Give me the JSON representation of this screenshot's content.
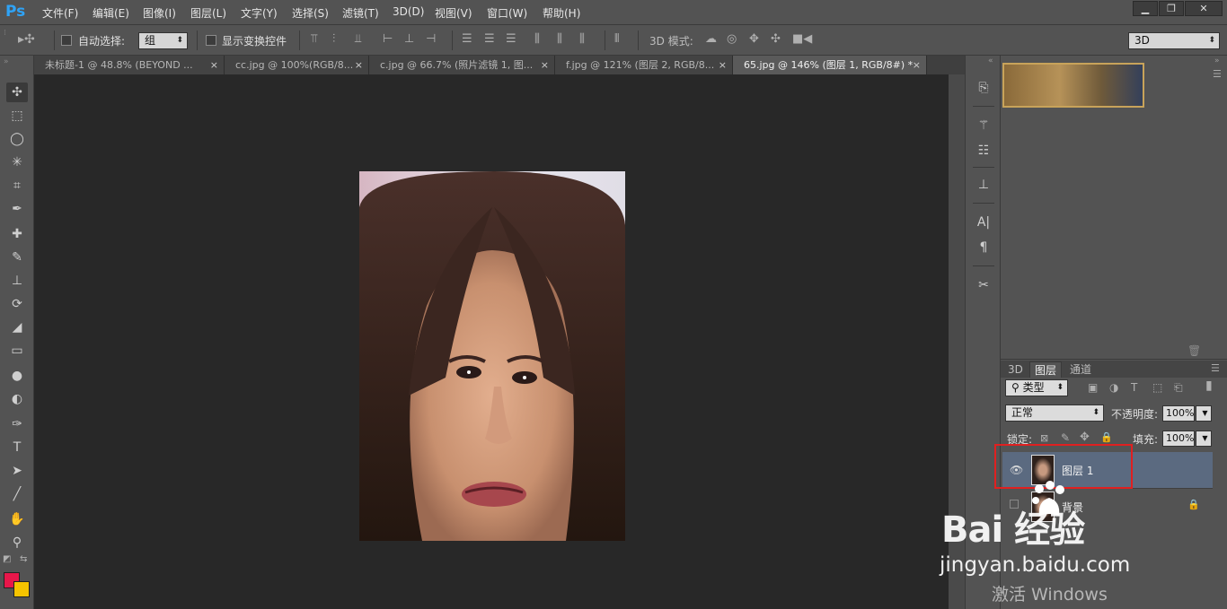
{
  "app": {
    "logo": "Ps",
    "menu": [
      "文件(F)",
      "编辑(E)",
      "图像(I)",
      "图层(L)",
      "文字(Y)",
      "选择(S)",
      "滤镜(T)",
      "3D(D)",
      "视图(V)",
      "窗口(W)",
      "帮助(H)"
    ],
    "window_buttons": [
      "▁",
      "❐",
      "✕"
    ]
  },
  "options": {
    "auto_select_label": "自动选择:",
    "auto_select_value": "组",
    "show_transform_label": "显示变换控件",
    "mode_3d_label": "3D 模式:",
    "workspace_value": "3D"
  },
  "tabs": [
    {
      "label": "未标题-1 @ 48.8% (BEYOND ...",
      "close": "×"
    },
    {
      "label": "cc.jpg @ 100%(RGB/8...",
      "close": "×"
    },
    {
      "label": "c.jpg @ 66.7% (照片滤镜 1, 图...",
      "close": "×"
    },
    {
      "label": "f.jpg @ 121% (图层 2, RGB/8...",
      "close": "×"
    },
    {
      "label": "65.jpg @ 146% (图层 1, RGB/8#) *",
      "close": "×"
    }
  ],
  "panel_tabs": [
    "3D",
    "图层",
    "通道"
  ],
  "layers_panel": {
    "filter_kind": "类型",
    "blend_mode": "正常",
    "opacity_label": "不透明度:",
    "opacity_value": "100%",
    "lock_label": "锁定:",
    "fill_label": "填充:",
    "fill_value": "100%",
    "layers": [
      {
        "name": "图层 1",
        "selected": true
      },
      {
        "name": "背景",
        "locked": true
      }
    ]
  },
  "colors": {
    "foreground": "#e8174a",
    "background": "#f6c400"
  },
  "watermark": {
    "logo": "Bai  经验",
    "url": "jingyan.baidu.com",
    "activate": "激活 Windows"
  }
}
